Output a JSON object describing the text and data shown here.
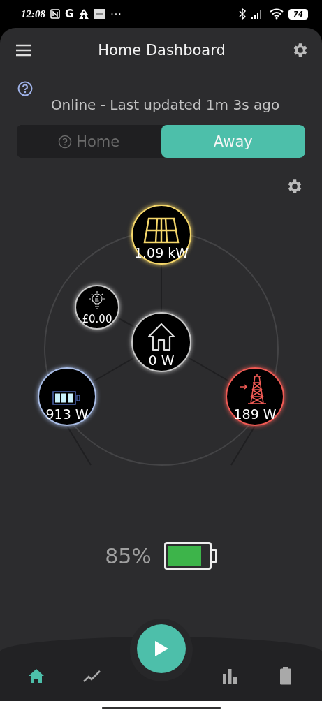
{
  "status_bar": {
    "time": "12:08",
    "letter_icon": "G",
    "more": "···",
    "battery": "74"
  },
  "header": {
    "title": "Home Dashboard"
  },
  "status_text": "Online - Last updated 1m 3s ago",
  "mode_toggle": [
    {
      "label": "Home",
      "selected": false
    },
    {
      "label": "Away",
      "selected": true
    }
  ],
  "flow_nodes": [
    {
      "kind": "solar",
      "value": "1.09 kW",
      "color": "#f5d76a"
    },
    {
      "kind": "cost",
      "value": "£0.00",
      "color": "#c8c8c8"
    },
    {
      "kind": "home",
      "value": "0 W",
      "color": "#c8c8c8"
    },
    {
      "kind": "battery",
      "value": "913 W",
      "color": "#a9bde6"
    },
    {
      "kind": "grid",
      "value": "189 W",
      "color": "#ef5a54"
    }
  ],
  "battery_summary": {
    "percent": "85%"
  },
  "bottom_nav": [
    {
      "kind": "home",
      "selected": true
    },
    {
      "kind": "chart",
      "selected": false
    },
    {
      "kind": "play",
      "selected": false
    },
    {
      "kind": "bars",
      "selected": false
    },
    {
      "kind": "battery",
      "selected": false
    }
  ]
}
